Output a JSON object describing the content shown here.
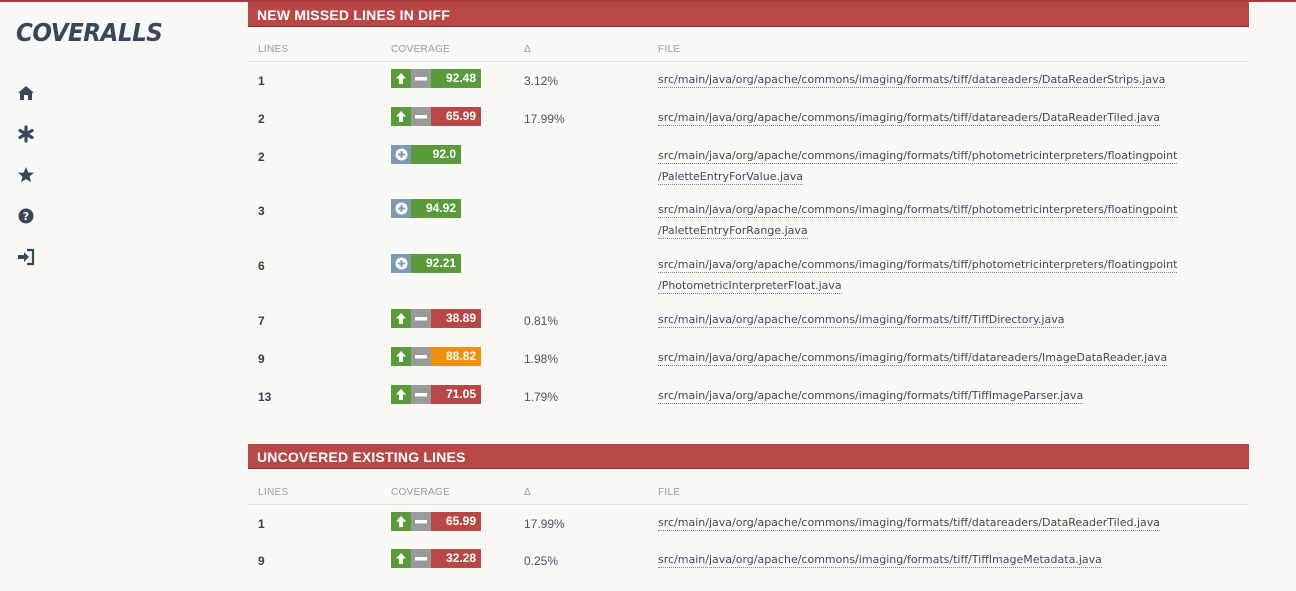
{
  "app": {
    "logo": "COVERALLS"
  },
  "nav": [
    {
      "icon": "home-icon"
    },
    {
      "icon": "asterisk-icon"
    },
    {
      "icon": "star-icon"
    },
    {
      "icon": "question-icon"
    },
    {
      "icon": "sign-in-icon"
    }
  ],
  "colors": {
    "red": "#b84848",
    "green": "#5a9a3a",
    "orange": "#f0900a",
    "gray": "#9a9a9a",
    "blue": "#7e9ab2"
  },
  "missed": {
    "title": "NEW MISSED LINES IN DIFF",
    "headers": {
      "lines": "LINES",
      "coverage": "COVERAGE",
      "delta": "Δ",
      "file": "FILE"
    },
    "rows": [
      {
        "lines": "1",
        "coverage": "92.48",
        "delta": "3.12%",
        "file": "src/main/java/org/apache/commons/imaging/formats/tiff/datareaders/DataReaderStrips.java",
        "kind": "change",
        "level": "green"
      },
      {
        "lines": "2",
        "coverage": "65.99",
        "delta": "17.99%",
        "file": "src/main/java/org/apache/commons/imaging/formats/tiff/datareaders/DataReaderTiled.java",
        "kind": "change",
        "level": "red"
      },
      {
        "lines": "2",
        "coverage": "92.0",
        "delta": "",
        "file": "src/main/java/org/apache/commons/imaging/formats/tiff/photometricinterpreters/floatingpoint\n/PaletteEntryForValue.java",
        "kind": "new",
        "level": "green"
      },
      {
        "lines": "3",
        "coverage": "94.92",
        "delta": "",
        "file": "src/main/java/org/apache/commons/imaging/formats/tiff/photometricinterpreters/floatingpoint\n/PaletteEntryForRange.java",
        "kind": "new",
        "level": "green"
      },
      {
        "lines": "6",
        "coverage": "92.21",
        "delta": "",
        "file": "src/main/java/org/apache/commons/imaging/formats/tiff/photometricinterpreters/floatingpoint\n/PhotometricInterpreterFloat.java",
        "kind": "new",
        "level": "green"
      },
      {
        "lines": "7",
        "coverage": "38.89",
        "delta": "0.81%",
        "file": "src/main/java/org/apache/commons/imaging/formats/tiff/TiffDirectory.java",
        "kind": "change",
        "level": "red"
      },
      {
        "lines": "9",
        "coverage": "88.82",
        "delta": "1.98%",
        "file": "src/main/java/org/apache/commons/imaging/formats/tiff/datareaders/ImageDataReader.java",
        "kind": "change",
        "level": "orange"
      },
      {
        "lines": "13",
        "coverage": "71.05",
        "delta": "1.79%",
        "file": "src/main/java/org/apache/commons/imaging/formats/tiff/TiffImageParser.java",
        "kind": "change",
        "level": "red"
      }
    ]
  },
  "uncovered": {
    "title": "UNCOVERED EXISTING LINES",
    "headers": {
      "lines": "LINES",
      "coverage": "COVERAGE",
      "delta": "Δ",
      "file": "FILE"
    },
    "rows": [
      {
        "lines": "1",
        "coverage": "65.99",
        "delta": "17.99%",
        "file": "src/main/java/org/apache/commons/imaging/formats/tiff/datareaders/DataReaderTiled.java",
        "kind": "change",
        "level": "red"
      },
      {
        "lines": "9",
        "coverage": "32.28",
        "delta": "0.25%",
        "file": "src/main/java/org/apache/commons/imaging/formats/tiff/TiffImageMetadata.java",
        "kind": "change",
        "level": "red"
      }
    ]
  }
}
